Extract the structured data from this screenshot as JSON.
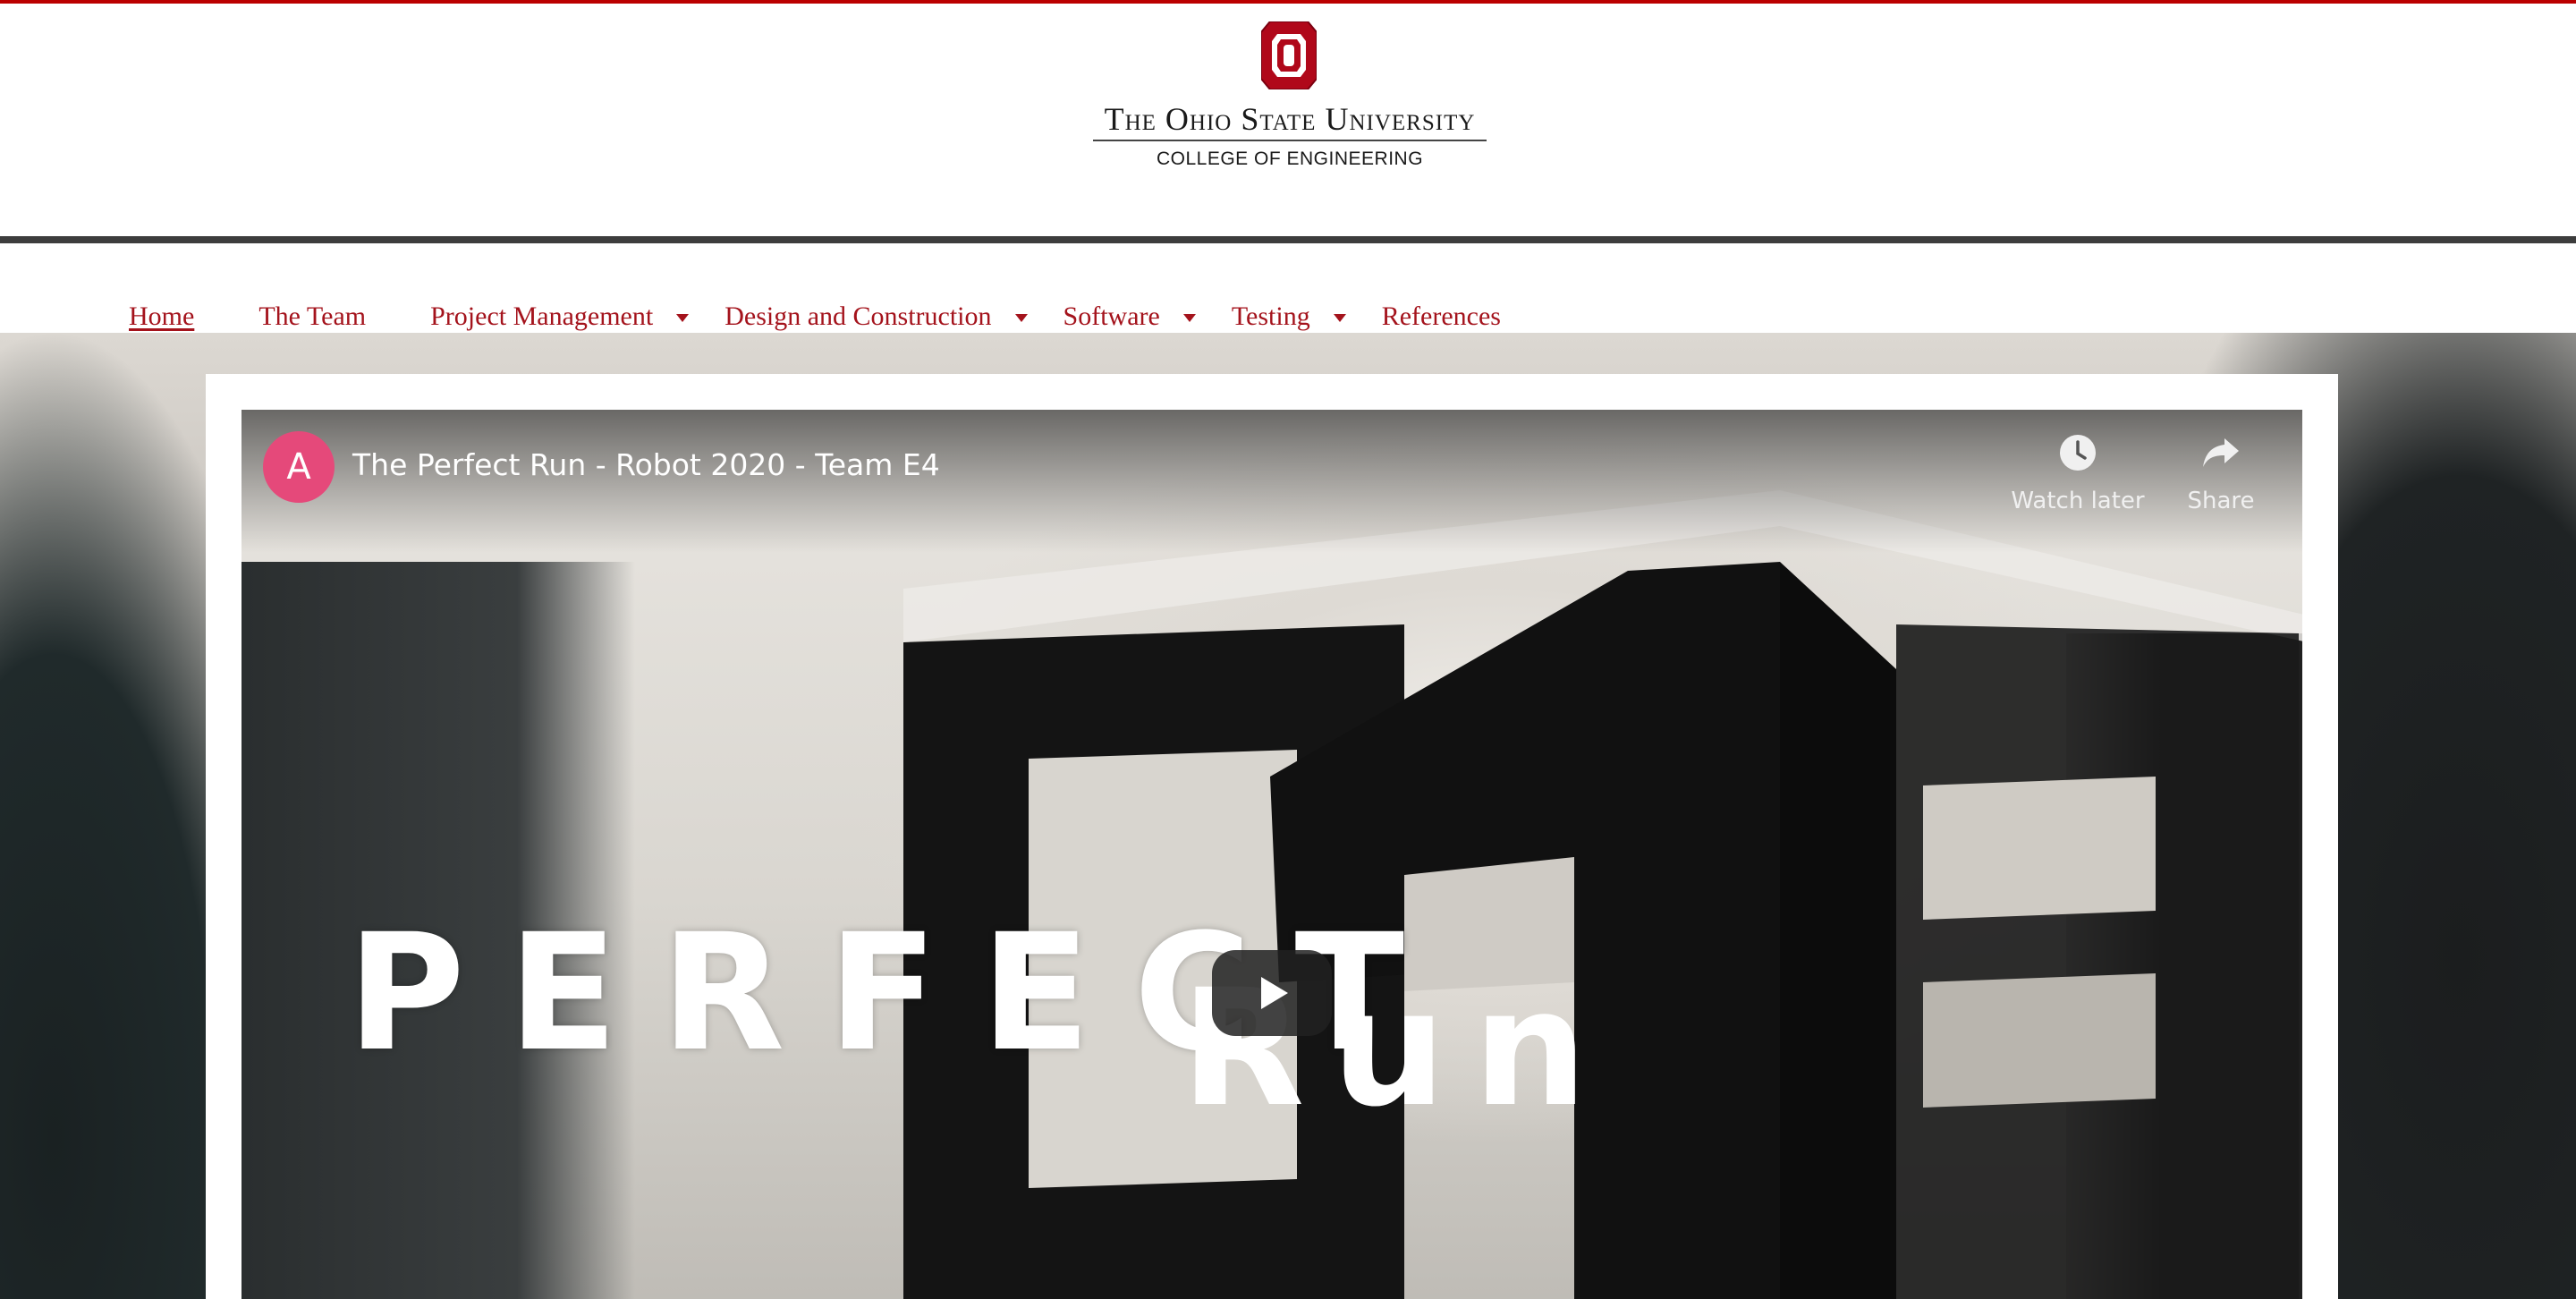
{
  "header": {
    "university": "The Ohio State University",
    "college": "COLLEGE OF ENGINEERING"
  },
  "nav": {
    "items": [
      {
        "label": "Home",
        "active": true,
        "has_dropdown": false
      },
      {
        "label": "The Team",
        "active": false,
        "has_dropdown": false
      },
      {
        "label": "Project Management",
        "active": false,
        "has_dropdown": true
      },
      {
        "label": "Design and Construction",
        "active": false,
        "has_dropdown": true
      },
      {
        "label": "Software",
        "active": false,
        "has_dropdown": true
      },
      {
        "label": "Testing",
        "active": false,
        "has_dropdown": true
      },
      {
        "label": "References",
        "active": false,
        "has_dropdown": false
      }
    ]
  },
  "video": {
    "channel_initial": "A",
    "title": "The Perfect Run - Robot 2020 - Team E4",
    "watch_later_label": "Watch later",
    "share_label": "Share",
    "overlay_text_1": "PERFECT",
    "overlay_text_2": "Run"
  },
  "colors": {
    "accent": "#bb0000",
    "nav_link": "#a4131c",
    "header_bar": "#3d3d3d",
    "avatar": "#e5497a"
  }
}
